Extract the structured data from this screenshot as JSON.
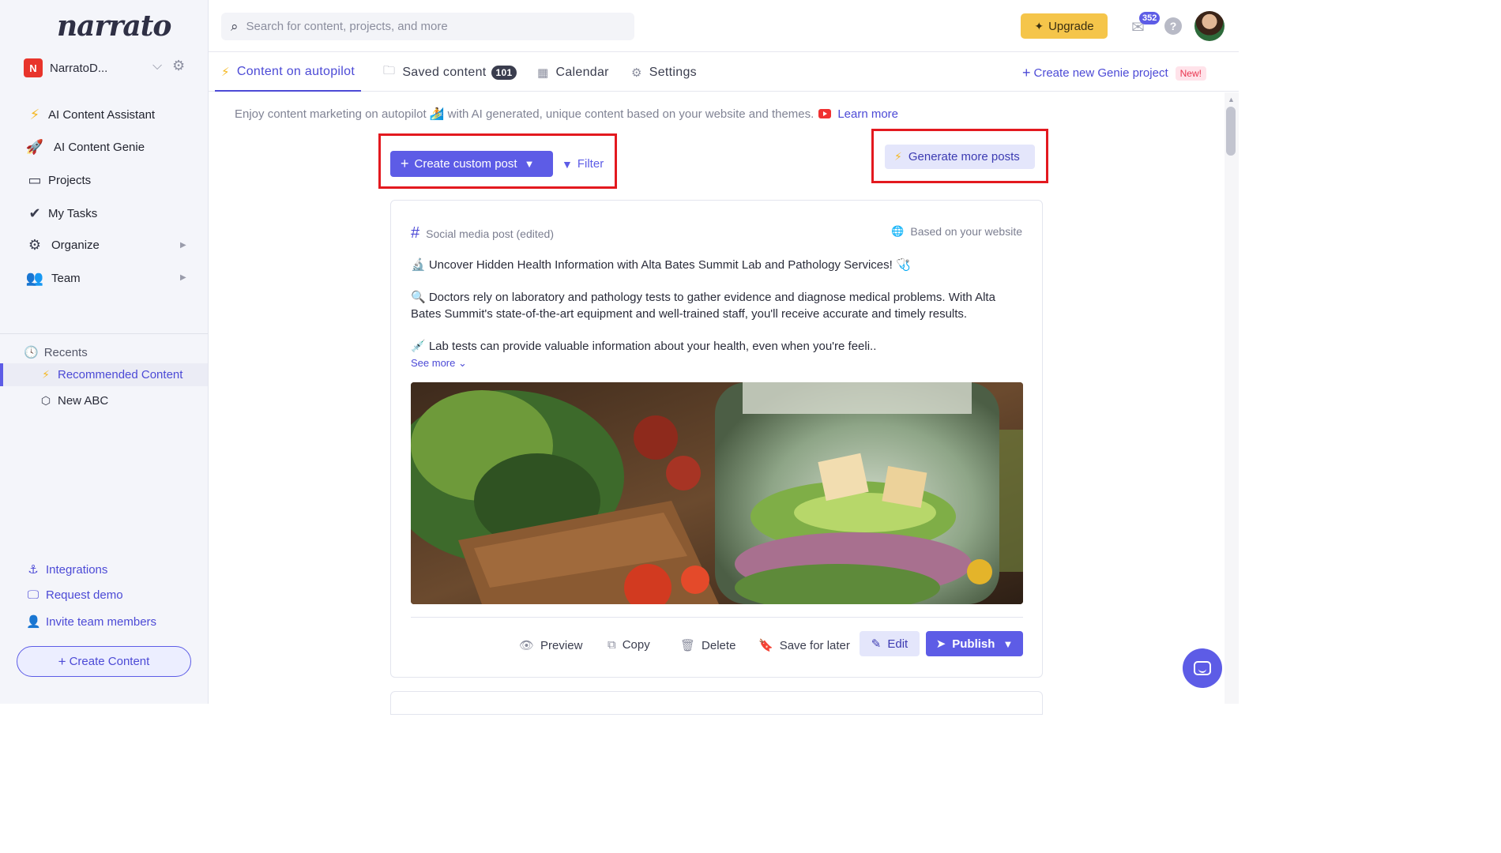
{
  "sidebar": {
    "logo": "narrato",
    "workspace": {
      "initial": "N",
      "name": "NarratoD..."
    },
    "nav": [
      {
        "label": "AI Content Assistant",
        "icon": "bolt-icon"
      },
      {
        "label": "AI Content Genie",
        "icon": "rocket-icon"
      },
      {
        "label": "Projects",
        "icon": "briefcase-icon"
      },
      {
        "label": "My Tasks",
        "icon": "checkmark-icon"
      },
      {
        "label": "Organize",
        "icon": "gears-icon"
      },
      {
        "label": "Team",
        "icon": "team-icon"
      }
    ],
    "recents": {
      "title": "Recents",
      "items": [
        {
          "label": "Recommended Content",
          "icon": "bolt-icon"
        },
        {
          "label": "New ABC",
          "icon": "cube-icon"
        }
      ]
    },
    "bottom_links": [
      {
        "label": "Integrations",
        "icon": "anchor-icon"
      },
      {
        "label": "Request demo",
        "icon": "monitor-icon"
      },
      {
        "label": "Invite team members",
        "icon": "add-user-icon"
      }
    ],
    "create_content": "Create Content"
  },
  "topbar": {
    "search_placeholder": "Search for content, projects, and more",
    "upgrade": "Upgrade",
    "mail_count": "352",
    "help": "?"
  },
  "tabs": [
    {
      "label": "Content on autopilot",
      "icon": "bolt-icon"
    },
    {
      "label": "Saved content",
      "count": "101",
      "icon": "folder-icon"
    },
    {
      "label": "Calendar",
      "icon": "calendar-icon"
    },
    {
      "label": "Settings",
      "icon": "gear-icon"
    }
  ],
  "new_project": {
    "label": "Create new Genie project",
    "badge": "New!"
  },
  "main": {
    "intro": "Enjoy content marketing on autopilot 🏄 with AI generated, unique content based on your website and themes.",
    "learn_more": "Learn more",
    "create_post": "Create custom post",
    "filter": "Filter",
    "generate": "Generate more posts"
  },
  "card": {
    "type": "Social media post (edited)",
    "source": "Based on your website",
    "paragraphs": [
      "🔬 Uncover Hidden Health Information with Alta Bates Summit Lab and Pathology Services! 🩺",
      "🔍 Doctors rely on laboratory and pathology tests to gather evidence and diagnose medical problems. With Alta Bates Summit's state-of-the-art equipment and well-trained staff, you'll receive accurate and timely results.",
      "💉 Lab tests can provide valuable information about your health, even when you're feeli.."
    ],
    "see_more": "See more",
    "actions": {
      "preview": "Preview",
      "copy": "Copy",
      "delete": "Delete",
      "save": "Save for later",
      "edit": "Edit",
      "publish": "Publish"
    }
  },
  "colors": {
    "accent": "#5d5ce6",
    "upgrade": "#f5c54a",
    "highlight": "#e3191f",
    "bolt": "#f5b823"
  }
}
